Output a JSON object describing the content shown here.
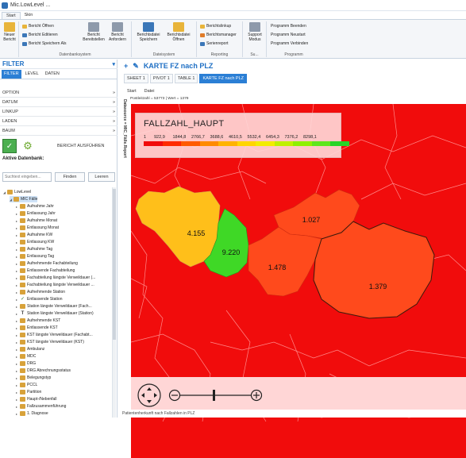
{
  "window": {
    "title": "Mic.LowLevel ..."
  },
  "ribbon_tabs": [
    "Start",
    "Skin"
  ],
  "ribbon": {
    "groups": [
      {
        "label": "",
        "buttons": [
          {
            "label": "Neuer\nBericht",
            "icon": "new-report-icon"
          }
        ]
      },
      {
        "label": "Datenbanksystem",
        "items": [
          "Bericht Öffnen",
          "Bericht Editieren",
          "Bericht Speichern Als"
        ],
        "buttons": [
          {
            "label": "Bericht\nBereitstellen",
            "icon": "deploy-report-icon"
          },
          {
            "label": "Bericht\nAnfordern",
            "icon": "request-report-icon"
          }
        ]
      },
      {
        "label": "Dateisystem",
        "buttons": [
          {
            "label": "Berichtsdatei\nSpeichern",
            "icon": "save-file-icon"
          },
          {
            "label": "Berichtsdatei\nÖffnen",
            "icon": "open-file-icon"
          }
        ]
      },
      {
        "label": "Reporting",
        "items": [
          "Berichtslinkup",
          "Berichtsmanager",
          "Serienreport"
        ]
      },
      {
        "label": "Su...",
        "buttons": [
          {
            "label": "Support\nModus",
            "icon": "support-icon"
          }
        ]
      },
      {
        "label": "Programm",
        "items": [
          "Programm Beenden",
          "Programm Neustart",
          "Programm Verbinden"
        ]
      }
    ]
  },
  "left": {
    "title": "FILTER",
    "tabs": [
      "FILTER",
      "LEVEL",
      "DATEN"
    ],
    "sections": [
      "OPTION",
      "DATUM",
      "LINKUP",
      "LADEN",
      "BAUM"
    ],
    "run_label": "BERICHT AUSFÜHREN",
    "db_header": "Aktive Datenbank:",
    "search_placeholder": "Suchtext eingeben...",
    "find_label": "Finden",
    "clear_label": "Leeren",
    "tree": [
      {
        "label": "LowLevel",
        "indent": 0,
        "icon": "db"
      },
      {
        "label": "MIC Fälle",
        "indent": 1,
        "icon": "db",
        "sel": true
      },
      {
        "label": "Aufnahme Jahr",
        "indent": 2
      },
      {
        "label": "Entlassung Jahr",
        "indent": 2
      },
      {
        "label": "Aufnahme Monat",
        "indent": 2
      },
      {
        "label": "Entlassung Monat",
        "indent": 2
      },
      {
        "label": "Aufnahme KW",
        "indent": 2
      },
      {
        "label": "Entlassung KW",
        "indent": 2
      },
      {
        "label": "Aufnahme Tag",
        "indent": 2
      },
      {
        "label": "Entlassung Tag",
        "indent": 2
      },
      {
        "label": "Aufnehmende Fachabteilung",
        "indent": 2
      },
      {
        "label": "Entlassende Fachabteilung",
        "indent": 2
      },
      {
        "label": "Fachabteilung längste Verweildauer (...",
        "indent": 2
      },
      {
        "label": "Fachabteilung längste Verweildauer ...",
        "indent": 2
      },
      {
        "label": "Aufnehmende Station",
        "indent": 2
      },
      {
        "label": "Entlassende Station",
        "indent": 2,
        "icon": "check"
      },
      {
        "label": "Station längste Verweildauer (Fach...",
        "indent": 2
      },
      {
        "label": "Station längste Verweildauer (Station)",
        "indent": 2,
        "icon": "t"
      },
      {
        "label": "Aufnehmende KST",
        "indent": 2
      },
      {
        "label": "Entlassende KST",
        "indent": 2
      },
      {
        "label": "KST längste Verweildauer (Fachabt...",
        "indent": 2
      },
      {
        "label": "KST längste Verweildauer (KST)",
        "indent": 2
      },
      {
        "label": "Ambulanz",
        "indent": 2
      },
      {
        "label": "MDC",
        "indent": 2
      },
      {
        "label": "DRG",
        "indent": 2
      },
      {
        "label": "DRG Abrechnungsstatus",
        "indent": 2
      },
      {
        "label": "Belegungstyp",
        "indent": 2
      },
      {
        "label": "PCCL",
        "indent": 2
      },
      {
        "label": "Partition",
        "indent": 2
      },
      {
        "label": "Haupt-/Nebenfall",
        "indent": 2
      },
      {
        "label": "Fallzusammenführung",
        "indent": 2
      },
      {
        "label": "1. Diagnose",
        "indent": 2
      }
    ]
  },
  "main": {
    "title": "KARTE FZ nach PLZ",
    "tabs": [
      "SHEET 1",
      "PIVOT 1",
      "TABLE 1",
      "KARTE FZ nach PLZ"
    ],
    "menu": [
      "Start",
      "Datei"
    ],
    "info": "Postleitzahl = 53773 | Wert = 1379",
    "side_label": "Datasource = MIC_Fälle.Report",
    "legend_title": "FALLZAHL_HAUPT",
    "legend_labels": [
      "1",
      "922,9",
      "1844,8",
      "2766,7",
      "3688,6",
      "4610,5",
      "5532,4",
      "6454,3",
      "7376,2",
      "8298,1"
    ],
    "legend_colors": [
      "#f10c0c",
      "#ff2a00",
      "#ff5a00",
      "#ff8a00",
      "#ffb300",
      "#ffd500",
      "#f2ec00",
      "#bff000",
      "#8ef000",
      "#5ee61c",
      "#27d427"
    ],
    "regions": [
      {
        "label": "4.155",
        "color": "#ffbf1a"
      },
      {
        "label": "9.220",
        "color": "#3fd826"
      },
      {
        "label": "1.027",
        "color": "#ff4a1c"
      },
      {
        "label": "1.478",
        "color": "#ff4a1c"
      },
      {
        "label": "1.379",
        "color": "#ff4a1c"
      }
    ],
    "status": "Patientenherkunft nach Fallzahlen in PLZ"
  }
}
